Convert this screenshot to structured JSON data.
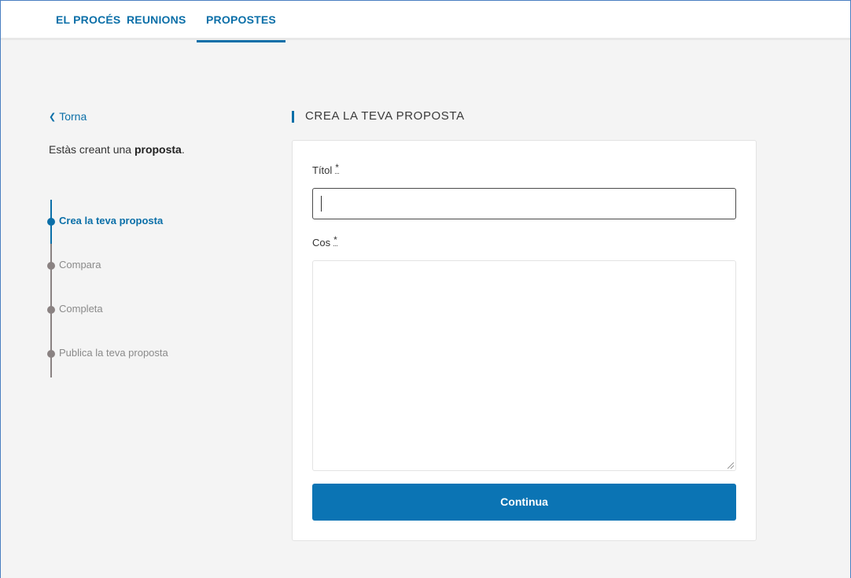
{
  "nav": {
    "tabs": [
      {
        "label": "EL PROCÉS"
      },
      {
        "label": "REUNIONS"
      },
      {
        "label": "PROPOSTES"
      }
    ],
    "active": "PROPOSTES"
  },
  "sidebar": {
    "back_label": "Torna",
    "intro_prefix": "Estàs creant una",
    "intro_bold": "proposta",
    "intro_suffix": ".",
    "steps": [
      {
        "label": "Crea la teva proposta",
        "active": true
      },
      {
        "label": "Compara",
        "active": false
      },
      {
        "label": "Completa",
        "active": false
      },
      {
        "label": "Publica la teva proposta",
        "active": false
      }
    ]
  },
  "form": {
    "title": "CREA LA TEVA PROPOSTA",
    "title_field": {
      "label": "Títol",
      "required_mark": "*",
      "value": ""
    },
    "body_field": {
      "label": "Cos",
      "required_mark": "*",
      "value": ""
    },
    "submit_label": "Continua"
  },
  "colors": {
    "accent": "#0b74b4",
    "step_inactive": "#8a8282"
  }
}
